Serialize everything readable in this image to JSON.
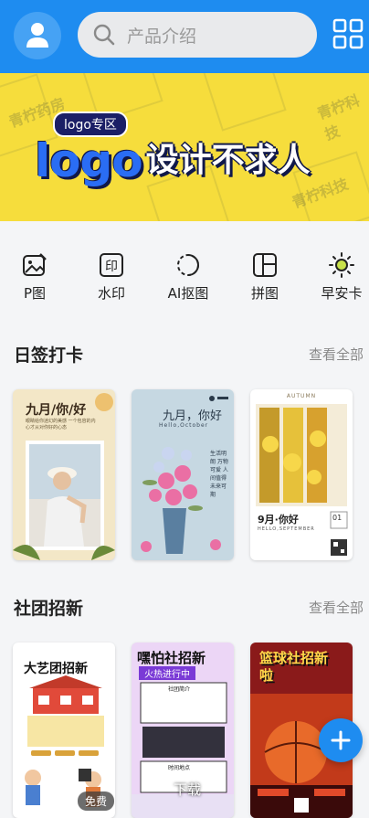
{
  "search": {
    "placeholder": "产品介绍"
  },
  "banner": {
    "tag": "logo专区",
    "title_logo": "logo",
    "title_cn": "设计不求人",
    "watermark": "青柠科技",
    "watermark2": "青柠药房",
    "slides": 3,
    "active_slide": 2
  },
  "tools": [
    {
      "label": "P图",
      "icon": "photo-edit-icon"
    },
    {
      "label": "水印",
      "icon": "watermark-icon"
    },
    {
      "label": "AI抠图",
      "icon": "ai-cutout-icon"
    },
    {
      "label": "拼图",
      "icon": "collage-icon"
    },
    {
      "label": "早安卡",
      "icon": "sun-icon"
    }
  ],
  "section1": {
    "title": "日签打卡",
    "more": "查看全部",
    "cards": [
      {
        "title": "九月/你/好",
        "subtitle": "眼睛给你迷幻的美感 一个包容的内心才从对你好的心态",
        "theme": "warm photo"
      },
      {
        "title": "九月，你好",
        "subtitle": "Hello,October",
        "side": "生活明朗 万物可爱 人间值得 未来可期"
      },
      {
        "title": "9月·你好",
        "subtitle": "HELLO,SEPTEMBER",
        "top": "AUTUMN",
        "date": "01"
      }
    ]
  },
  "section2": {
    "title": "社团招新",
    "more": "查看全部",
    "cards": [
      {
        "title": "大艺团招新"
      },
      {
        "title": "嘿怕社招新",
        "subtitle": "火热进行中",
        "box1": "社团简介",
        "box2": "时间地点"
      },
      {
        "title": "篮球社招新啦"
      }
    ]
  },
  "badges": {
    "free": "免费",
    "download": "下载"
  },
  "colors": {
    "accent": "#1e8cf0",
    "banner": "#f6dd3c"
  }
}
